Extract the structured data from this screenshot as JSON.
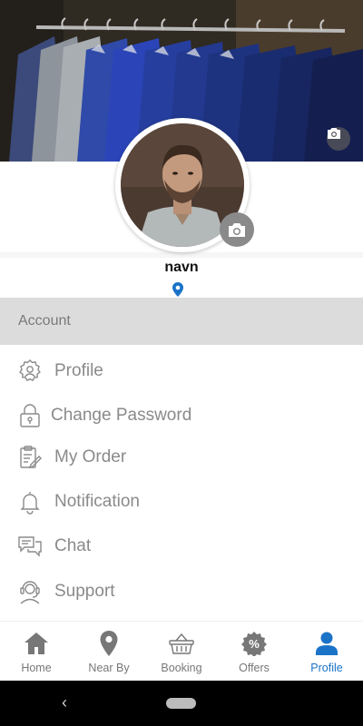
{
  "profile": {
    "name": "navn"
  },
  "account_section": {
    "header": "Account"
  },
  "menu": [
    {
      "label": "Profile",
      "icon": "gear-user-icon"
    },
    {
      "label": "Change Password",
      "icon": "lock-icon"
    },
    {
      "label": "My Order",
      "icon": "order-document-icon"
    },
    {
      "label": "Notification",
      "icon": "bell-icon"
    },
    {
      "label": "Chat",
      "icon": "chat-bubbles-icon"
    },
    {
      "label": "Support",
      "icon": "support-agent-icon"
    }
  ],
  "bottom_nav": [
    {
      "label": "Home",
      "icon": "home-icon",
      "active": false
    },
    {
      "label": "Near By",
      "icon": "map-pin-icon",
      "active": false
    },
    {
      "label": "Booking",
      "icon": "basket-icon",
      "active": false
    },
    {
      "label": "Offers",
      "icon": "percent-badge-icon",
      "active": false
    },
    {
      "label": "Profile",
      "icon": "person-icon",
      "active": true
    }
  ],
  "colors": {
    "accent": "#1a73c7",
    "icon_gray": "#777777",
    "header_bg": "#dcdcdc"
  }
}
